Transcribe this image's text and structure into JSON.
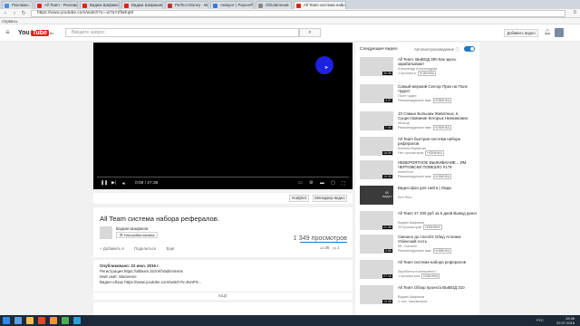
{
  "browser": {
    "tabs": [
      {
        "label": "Реклама",
        "color": "#4a90d9"
      },
      {
        "label": "All Team - Реклама и за...",
        "color": "#e62117"
      },
      {
        "label": "Вадим Шафиков",
        "color": "#e62117"
      },
      {
        "label": "Вадим Шафиков - YouT...",
        "color": "#e62117"
      },
      {
        "label": "Perfect Money - Way to...",
        "color": "#d03030"
      },
      {
        "label": "Аккаунт | Payeer® E-W...",
        "color": "#3a7bd5"
      },
      {
        "label": "Объявления",
        "color": "#888888"
      },
      {
        "label": "All Team система набо...",
        "color": "#e62117",
        "active": true
      }
    ],
    "url": "https://www.youtube.com/watch?v=-w7aYZfwEqM",
    "bookmarks": "Сервисы"
  },
  "youtube": {
    "logo_text": "You",
    "logo_tube": "Tube",
    "logo_suffix": "RU",
    "search_placeholder": "Введите запрос",
    "add_video": "Добавить видео"
  },
  "player": {
    "time": "0:08 / 27:38"
  },
  "below_player": {
    "analytics": "Analytics",
    "video_manager": "Менеджер видео"
  },
  "video": {
    "title": "All Team система набора рефералов.",
    "channel": "Вадим Шафиков",
    "settings_button": "Настройки канала",
    "views": "1 349 просмотров",
    "likes": "26",
    "dislikes": "1",
    "actions": [
      "+ Добавить в",
      "Поделиться",
      "Ещё"
    ]
  },
  "description": {
    "published": "Опубликовано: 22 июл. 2016 г.",
    "line1": "Регистрация https://allteam.biz/ref/VadimVeme",
    "line2": "Мой сайт: Mariveme",
    "line3": "Видео-обзор https://www.youtube.com/watch?v=9vnPS...",
    "more": "ЕЩЁ"
  },
  "sidebar": {
    "heading": "Следующее видео",
    "autoplay": "Автовоспроизведение",
    "videos": [
      {
        "title": "All Team: ВЫВОД 390 Как здесь зарабатывают",
        "channel": "Александр Александров",
        "meta": "1 просмотр",
        "badge": "НОВИНКА",
        "duration": "30:35"
      },
      {
        "title": "Самый мерзкий Сектор Приз на Поле Чудес!",
        "channel": "Поле Чудес",
        "meta": "Рекомендуемые вам",
        "badge": "НОВИНКА",
        "duration": "3:37"
      },
      {
        "title": "10 Самых Больших Животных, в Существование Которых Невозможно",
        "channel": "Мозгод",
        "meta": "Рекомендуемые вам",
        "badge": "НОВИНКА",
        "duration": "7:40"
      },
      {
        "title": "All Team быстрая система набора рефералов",
        "channel": "Ксения Мирлитан",
        "meta": "Нет просмотров",
        "badge": "НОВИНКА",
        "duration": "16:59"
      },
      {
        "title": "НЕВЕРОЯТНОЕ ВЫЖИВАНИЕ... ИМ ЧЕРТОВСКИ ПОВЕЗЛО #179",
        "channel": "mobeGod",
        "meta": "Рекомендуемые вам",
        "badge": "НОВИНКА",
        "duration": "10:26"
      },
      {
        "title": "Видео-фон для сайта | Люди",
        "channel": "Ken Stuo",
        "meta": "",
        "badge": "",
        "duration": "",
        "thumb_text": "60 видео"
      },
      {
        "title": "All Team 27 200 руб за 6 дней Вывод денег",
        "channel": "Вадим Шафиков",
        "meta": "29 просмотров",
        "badge": "НОВИНКА",
        "duration": "21:36"
      },
      {
        "title": "Смешно до слез!!!2 Обед Атлюма-Узбекский гость",
        "channel": "Mr. Смешно",
        "meta": "Рекомендуемые вам",
        "badge": "НОВИНКА",
        "duration": "3:56"
      },
      {
        "title": "All Team система набора рефералов",
        "channel": "Заработок в интернете?",
        "meta": "1 просмотров",
        "badge": "НОВИНКА",
        "duration": "27:16"
      },
      {
        "title": "All Team Обзор проекта ВЫВОД 310",
        "channel": "Вадим Шафиков",
        "meta": "1 тыс. просмотров",
        "badge": "",
        "duration": "13:48"
      }
    ]
  },
  "taskbar": {
    "time": "19:46",
    "date": "22.07.2016",
    "lang": "РУС"
  }
}
